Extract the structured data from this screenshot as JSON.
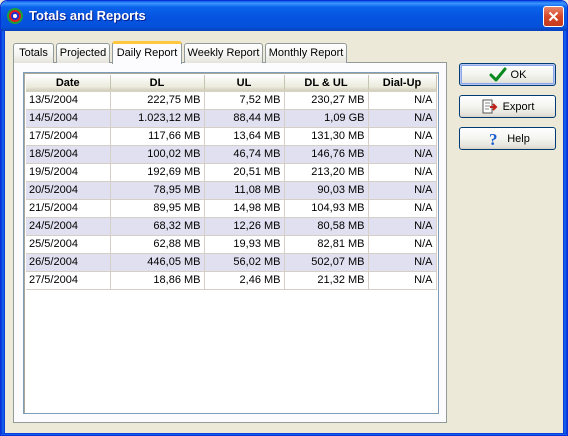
{
  "window": {
    "title": "Totals and Reports",
    "accent": "#0553E0"
  },
  "tabs": [
    {
      "label": "Totals",
      "active": false
    },
    {
      "label": "Projected",
      "active": false
    },
    {
      "label": "Daily Report",
      "active": true
    },
    {
      "label": "Weekly Report",
      "active": false
    },
    {
      "label": "Monthly Report",
      "active": false
    }
  ],
  "table": {
    "headers": [
      "Date",
      "DL",
      "UL",
      "DL & UL",
      "Dial-Up"
    ],
    "rows": [
      [
        "13/5/2004",
        "222,75 MB",
        "7,52 MB",
        "230,27 MB",
        "N/A"
      ],
      [
        "14/5/2004",
        "1.023,12 MB",
        "88,44 MB",
        "1,09 GB",
        "N/A"
      ],
      [
        "17/5/2004",
        "117,66 MB",
        "13,64 MB",
        "131,30 MB",
        "N/A"
      ],
      [
        "18/5/2004",
        "100,02 MB",
        "46,74 MB",
        "146,76 MB",
        "N/A"
      ],
      [
        "19/5/2004",
        "192,69 MB",
        "20,51 MB",
        "213,20 MB",
        "N/A"
      ],
      [
        "20/5/2004",
        "78,95 MB",
        "11,08 MB",
        "90,03 MB",
        "N/A"
      ],
      [
        "21/5/2004",
        "89,95 MB",
        "14,98 MB",
        "104,93 MB",
        "N/A"
      ],
      [
        "24/5/2004",
        "68,32 MB",
        "12,26 MB",
        "80,58 MB",
        "N/A"
      ],
      [
        "25/5/2004",
        "62,88 MB",
        "19,93 MB",
        "82,81 MB",
        "N/A"
      ],
      [
        "26/5/2004",
        "446,05 MB",
        "56,02 MB",
        "502,07 MB",
        "N/A"
      ],
      [
        "27/5/2004",
        "18,86 MB",
        "2,46 MB",
        "21,32 MB",
        "N/A"
      ]
    ]
  },
  "buttons": {
    "ok": {
      "label": "OK",
      "icon": "checkmark-icon"
    },
    "export": {
      "label": "Export",
      "icon": "export-icon"
    },
    "help": {
      "label": "Help",
      "icon": "help-icon"
    }
  }
}
